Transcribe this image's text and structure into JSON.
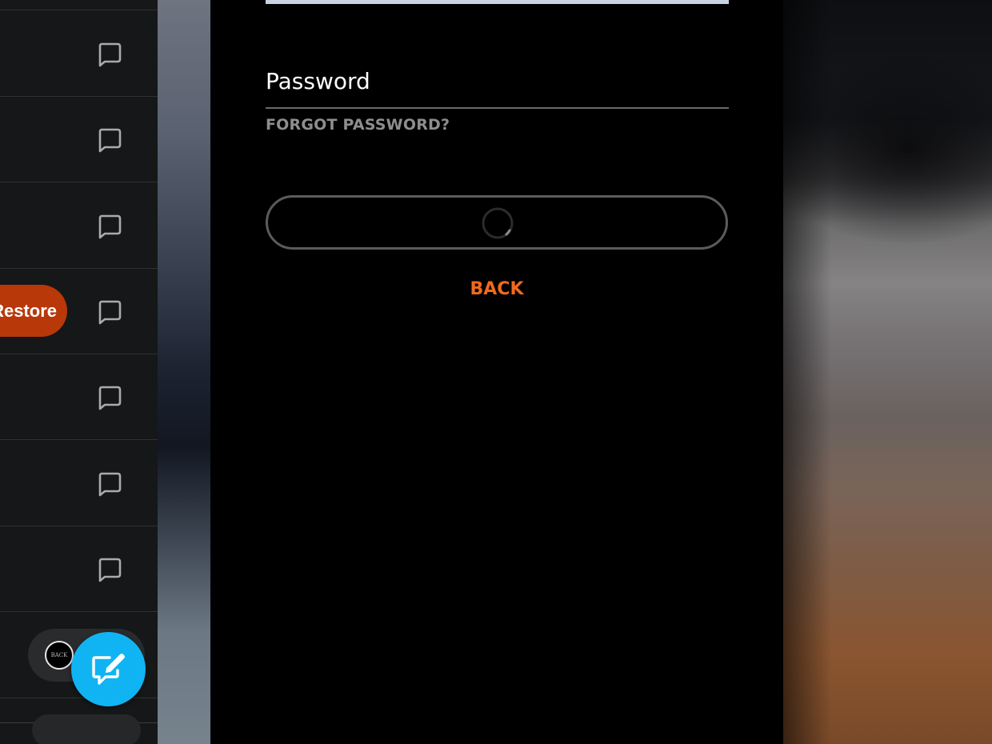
{
  "list": {
    "restore_label": "Restore",
    "avatar_label": "BACK"
  },
  "login": {
    "password_placeholder": "Password",
    "forgot_label": "FORGOT PASSWORD?",
    "submit_state": "loading",
    "back_label": "BACK"
  },
  "colors": {
    "accent_orange": "#ef6a1e",
    "restore_red": "#b8380a",
    "fab_blue": "#10b4f3",
    "panel_bg": "#161718"
  },
  "icons": {
    "row_icon": "chat-bubble-icon",
    "fab_icon": "compose-icon",
    "spinner": "loading-spinner"
  }
}
